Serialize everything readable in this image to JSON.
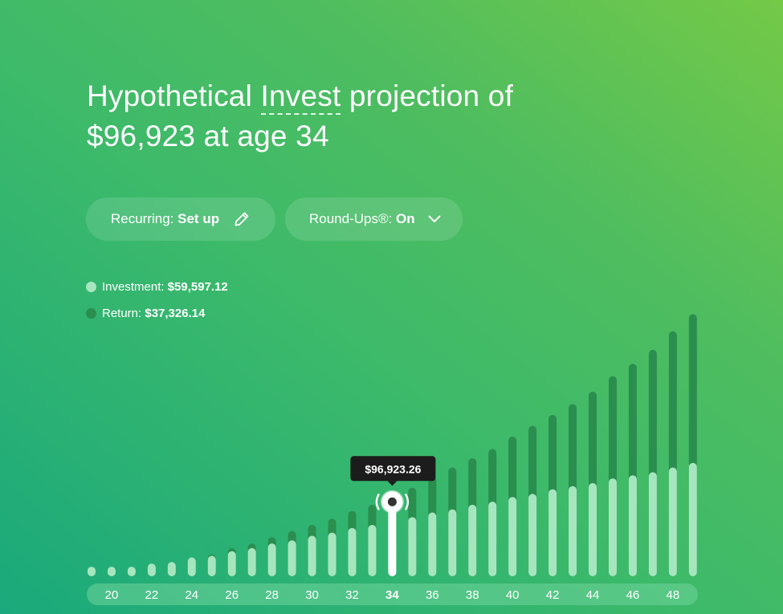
{
  "header": {
    "title_prefix": "Hypothetical ",
    "title_link": "Invest",
    "title_suffix": " projection of",
    "title_line2": "$96,923 at age 34"
  },
  "controls": {
    "recurring_label": "Recurring: ",
    "recurring_value": "Set up",
    "roundups_label": "Round-Ups®: ",
    "roundups_value": "On"
  },
  "legend": {
    "investment_label": "Investment: ",
    "investment_value": "$59,597.12",
    "return_label": "Return: ",
    "return_value": "$37,326.14"
  },
  "tooltip": {
    "value": "$96,923.26"
  },
  "colors": {
    "investment": "#a6e6bf",
    "return": "#2a8e4f",
    "selected": "#ffffff",
    "tooltip_bg": "#1c1c1c",
    "axis_bg": "#6fd39a"
  },
  "chart_data": {
    "type": "bar",
    "stacked": true,
    "x": [
      19,
      20,
      21,
      22,
      23,
      24,
      25,
      26,
      27,
      28,
      29,
      30,
      31,
      32,
      33,
      34,
      35,
      36,
      37,
      38,
      39,
      40,
      41,
      42,
      43,
      44,
      45,
      46,
      47,
      48,
      49
    ],
    "tick_labels": [
      "20",
      "22",
      "24",
      "26",
      "28",
      "30",
      "32",
      "34",
      "36",
      "38",
      "40",
      "42",
      "44",
      "46",
      "48"
    ],
    "tick_values": [
      20,
      22,
      24,
      26,
      28,
      30,
      32,
      34,
      36,
      38,
      40,
      42,
      44,
      46,
      48
    ],
    "series": [
      {
        "name": "Investment",
        "values": [
          1,
          1,
          1,
          3,
          4,
          7,
          8,
          11,
          13,
          16,
          18,
          21,
          23,
          26,
          28,
          31,
          33,
          36,
          38,
          41,
          43,
          46,
          48,
          51,
          53,
          55,
          58,
          60,
          62,
          65,
          68
        ]
      },
      {
        "name": "Return",
        "values": [
          0,
          0,
          0,
          0,
          0,
          0,
          1,
          2,
          3,
          4,
          6,
          7,
          9,
          11,
          13,
          16,
          19,
          23,
          27,
          30,
          34,
          39,
          44,
          48,
          53,
          59,
          66,
          72,
          79,
          88,
          96
        ]
      }
    ],
    "selected_index": 15,
    "selected_x": 34,
    "selected_total": 96923.26,
    "ylim": [
      0,
      171
    ],
    "units_note": "values in thousands of dollars (estimated)"
  }
}
